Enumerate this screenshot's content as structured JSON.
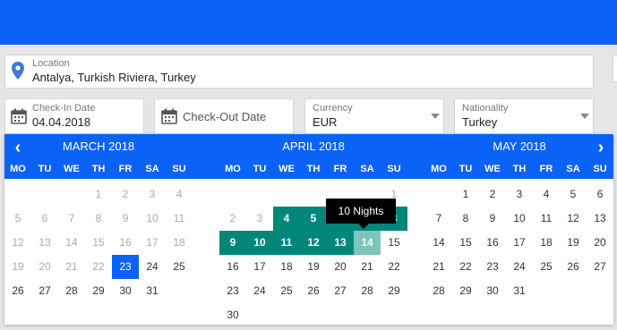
{
  "colors": {
    "brand": "#0b62f6",
    "range": "#00877a",
    "range_end": "#7fc3bc"
  },
  "location": {
    "label": "Location",
    "value": "Antalya, Turkish Riviera, Turkey"
  },
  "checkin": {
    "label": "Check-In Date",
    "value": "04.04.2018"
  },
  "checkout": {
    "placeholder": "Check-Out Date"
  },
  "currency": {
    "label": "Currency",
    "value": "EUR"
  },
  "nationality": {
    "label": "Nationality",
    "value": "Turkey"
  },
  "calendar": {
    "prev_icon": "chevron-left-icon",
    "next_icon": "chevron-right-icon",
    "weekdays": [
      "MO",
      "TU",
      "WE",
      "TH",
      "FR",
      "SA",
      "SU"
    ],
    "tooltip": "10 Nights",
    "months": [
      {
        "title": "MARCH 2018",
        "offset": 3,
        "days": 31,
        "past_until": 22,
        "selected": 23
      },
      {
        "title": "APRIL 2018",
        "offset": 6,
        "days": 30,
        "past_until": 3,
        "range_start": 4,
        "range_end": 14
      },
      {
        "title": "MAY 2018",
        "offset": 1,
        "days": 31
      }
    ]
  }
}
